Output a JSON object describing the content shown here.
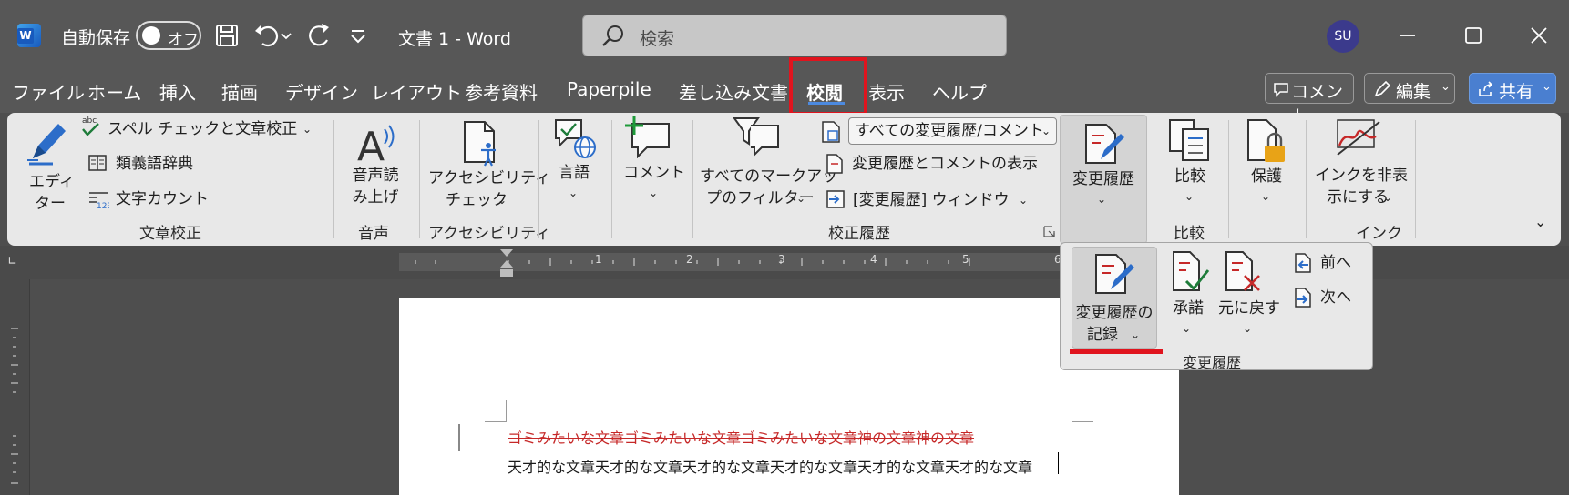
{
  "titlebar": {
    "app_letter": "W",
    "autosave_label": "自動保存",
    "autosave_state": "オフ",
    "doc_title": "文書 1  -  Word",
    "search_placeholder": "検索",
    "user_initials": "SU",
    "icons": [
      "save-icon",
      "undo-icon",
      "redo-icon",
      "customize-qat-icon",
      "minimize-icon",
      "maximize-icon",
      "close-icon"
    ]
  },
  "tabs": [
    {
      "label": "ファイル"
    },
    {
      "label": "ホーム"
    },
    {
      "label": "挿入"
    },
    {
      "label": "描画"
    },
    {
      "label": "デザイン"
    },
    {
      "label": "レイアウト"
    },
    {
      "label": "参考資料"
    },
    {
      "label": "Paperpile"
    },
    {
      "label": "差し込み文書"
    },
    {
      "label": "校閲",
      "active": true
    },
    {
      "label": "表示"
    },
    {
      "label": "ヘルプ"
    }
  ],
  "right_buttons": {
    "comment": "コメント",
    "edit": "編集",
    "share": "共有"
  },
  "ribbon": {
    "proofing": {
      "editor": [
        "エディ",
        "ター"
      ],
      "spelling": "スペル チェックと文章校正",
      "thesaurus": "類義語辞典",
      "word_count": "文字カウント",
      "group_label": "文章校正"
    },
    "speech": {
      "read_aloud": [
        "音声読",
        "み上げ"
      ],
      "group_label": "音声"
    },
    "accessibility": {
      "check": [
        "アクセシビリティ",
        "チェック"
      ],
      "group_label": "アクセシビリティ"
    },
    "language": {
      "label": "言語"
    },
    "comments": {
      "label": "コメント"
    },
    "tracking": {
      "filter": [
        "すべてのマークアッ",
        "プのフィルター"
      ],
      "markup_combo": "すべての変更履歴/コメント",
      "show_markup": "変更履歴とコメントの表示",
      "reviewing_pane": "[変更履歴] ウィンドウ",
      "group_label": "校正履歴"
    },
    "track_changes": {
      "label": "変更履歴"
    },
    "compare": {
      "label": "比較",
      "group_label": "比較"
    },
    "protect": {
      "label": "保護"
    },
    "ink": {
      "label": [
        "インクを非表",
        "示にする"
      ],
      "group_label": "インク"
    }
  },
  "flyout": {
    "track_changes": [
      "変更履歴の",
      "記録"
    ],
    "accept": "承諾",
    "reject": "元に戻す",
    "previous": "前へ",
    "next": "次へ",
    "group_label": "変更履歴"
  },
  "ruler": {
    "numbers": [
      "1",
      "2",
      "3",
      "4",
      "5",
      "6"
    ]
  },
  "document": {
    "deleted_text": "ゴミみたいな文章ゴミみたいな文章ゴミみたいな文章神の文章神の文章",
    "inserted_text": "天才的な文章天才的な文章天才的な文章天才的な文章天才的な文章天才的な文章"
  },
  "colors": {
    "accent": "#4c8ae0",
    "highlight_red": "#e0141e",
    "deleted_text": "#c62828"
  }
}
